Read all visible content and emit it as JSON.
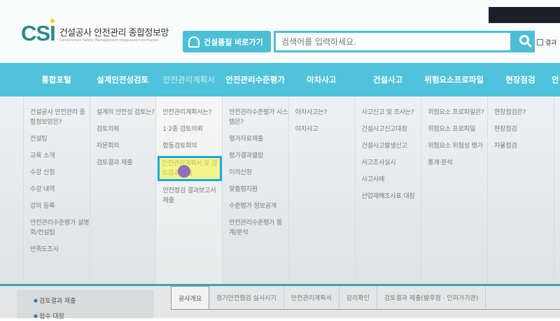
{
  "header": {
    "logo_mark": "CSI",
    "logo_title": "건설공사 안전관리 종합정보망",
    "logo_subtitle": "Construction Safety Management Integrated Information",
    "quick_link": "건설품질 바로가기",
    "search_placeholder": "검색어를 입력하세요.",
    "result_search_label": "결과"
  },
  "nav": [
    {
      "label": "통합포털",
      "items": [
        "건설공사 안전관리 종합정보망은?",
        "컨설팅",
        "교육 소개",
        "수강 신청",
        "수강 내역",
        "강의 등록",
        "안전관리수준평가 설명회/컨설팅",
        "만족도조사"
      ]
    },
    {
      "label": "설계안전성검토",
      "items": [
        "설계의 안전성 검토는?",
        "검토의뢰",
        "자문회의",
        "검토결과 제출"
      ]
    },
    {
      "label": "안전관리계획서",
      "items": [
        "안전관리계획서는?",
        "1·2종 검토의뢰",
        "합동검토회의",
        "안전관리계획서 및 검토결과 제출",
        "안전점검 결과보고서 제출"
      ]
    },
    {
      "label": "안전관리수준평가",
      "items": [
        "안전관리수준평가 시스템은?",
        "평가자료제출",
        "평가결과열람",
        "이의신청",
        "맞춤형지원",
        "수준평가 정보공개",
        "안전관리수준평가 통계/분석"
      ]
    },
    {
      "label": "아차사고",
      "items": [
        "아차사고는?",
        "아차사고"
      ]
    },
    {
      "label": "건설사고",
      "items": [
        "사고신고 및 조사는?",
        "건설사고신고대장",
        "건설사고발생신고",
        "사고조사실시",
        "사고사례",
        "산업재해조사표 대장"
      ]
    },
    {
      "label": "위험요소프로파일",
      "items": [
        "위험요소 프로파일은?",
        "위험요소 프로파일",
        "위험요소 위험성 평가",
        "통계·분석"
      ]
    },
    {
      "label": "현장점검",
      "items": [
        "현장점검은?",
        "현장점검",
        "자율점검"
      ]
    },
    {
      "label": "안",
      "items": []
    }
  ],
  "sidebar": [
    "검토결과 제출",
    "접수 대장"
  ],
  "tabs": [
    "공사개요",
    "정기안전점검 실시시기",
    "안전관리계획서",
    "감리확인",
    "검토결과 제출(발주청 · 인허가기관)"
  ]
}
